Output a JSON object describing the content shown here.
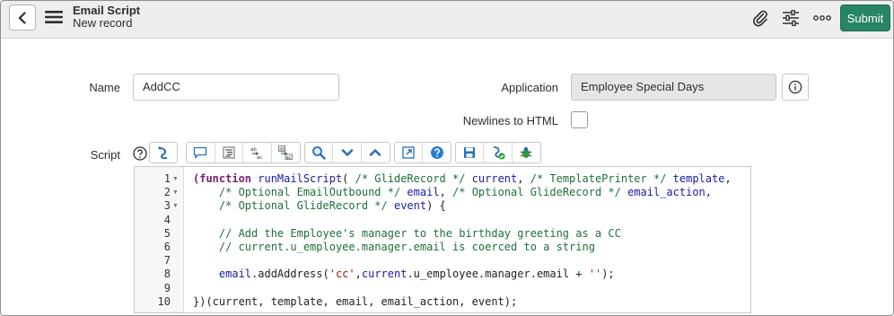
{
  "header": {
    "title": "Email Script",
    "subtitle": "New record",
    "submit_label": "Submit",
    "icons": [
      "back-icon",
      "menu-icon",
      "paperclip-icon",
      "sliders-icon",
      "more-icon"
    ]
  },
  "form": {
    "name_label": "Name",
    "name_value": "AddCC",
    "application_label": "Application",
    "application_value": "Employee Special Days",
    "newlines_label": "Newlines to HTML",
    "newlines_checked": false,
    "script_label": "Script"
  },
  "toolbar": {
    "groups": [
      [
        "toggle-syntax-icon"
      ],
      [
        "comment-icon",
        "format-icon",
        "replace-icon",
        "replace-all-icon"
      ],
      [
        "search-icon",
        "find-next-icon",
        "find-prev-icon"
      ],
      [
        "fullscreen-icon",
        "help-icon"
      ],
      [
        "save-icon",
        "syntax-check-icon",
        "debug-icon"
      ]
    ]
  },
  "editor": {
    "line_numbers": [
      "1",
      "2",
      "3",
      "4",
      "5",
      "6",
      "7",
      "8",
      "9",
      "10"
    ],
    "lines": [
      [
        [
          "kw",
          "(function "
        ],
        [
          "fn",
          "runMailScript"
        ],
        [
          "",
          "( "
        ],
        [
          "cm",
          "/* GlideRecord */"
        ],
        [
          "vr",
          " current"
        ],
        [
          "",
          ", "
        ],
        [
          "cm",
          "/* TemplatePrinter */"
        ],
        [
          "vr",
          " template"
        ],
        [
          "",
          ","
        ]
      ],
      [
        [
          "",
          "    "
        ],
        [
          "cm",
          "/* Optional EmailOutbound */"
        ],
        [
          "vr",
          " email"
        ],
        [
          "",
          ", "
        ],
        [
          "cm",
          "/* Optional GlideRecord */"
        ],
        [
          "vr",
          " email_action"
        ],
        [
          "",
          ","
        ]
      ],
      [
        [
          "",
          "    "
        ],
        [
          "cm",
          "/* Optional GlideRecord */"
        ],
        [
          "vr",
          " event"
        ],
        [
          "",
          ") {"
        ]
      ],
      [
        [
          "",
          ""
        ]
      ],
      [
        [
          "",
          "    "
        ],
        [
          "cm",
          "// Add the Employee's manager to the birthday greeting as a CC"
        ]
      ],
      [
        [
          "",
          "    "
        ],
        [
          "cm",
          "// current.u_employee.manager.email is coerced to a string"
        ]
      ],
      [
        [
          "",
          ""
        ]
      ],
      [
        [
          "",
          "    "
        ],
        [
          "vr",
          "email"
        ],
        [
          "",
          ".addAddress("
        ],
        [
          "st",
          "'cc'"
        ],
        [
          "",
          ","
        ],
        [
          "vr",
          "current"
        ],
        [
          "",
          ".u_employee.manager.email + "
        ],
        [
          "st",
          "''"
        ],
        [
          "",
          ");"
        ]
      ],
      [
        [
          "",
          ""
        ]
      ],
      [
        [
          "",
          "})(current, template, email, email_action, event);"
        ]
      ]
    ]
  }
}
